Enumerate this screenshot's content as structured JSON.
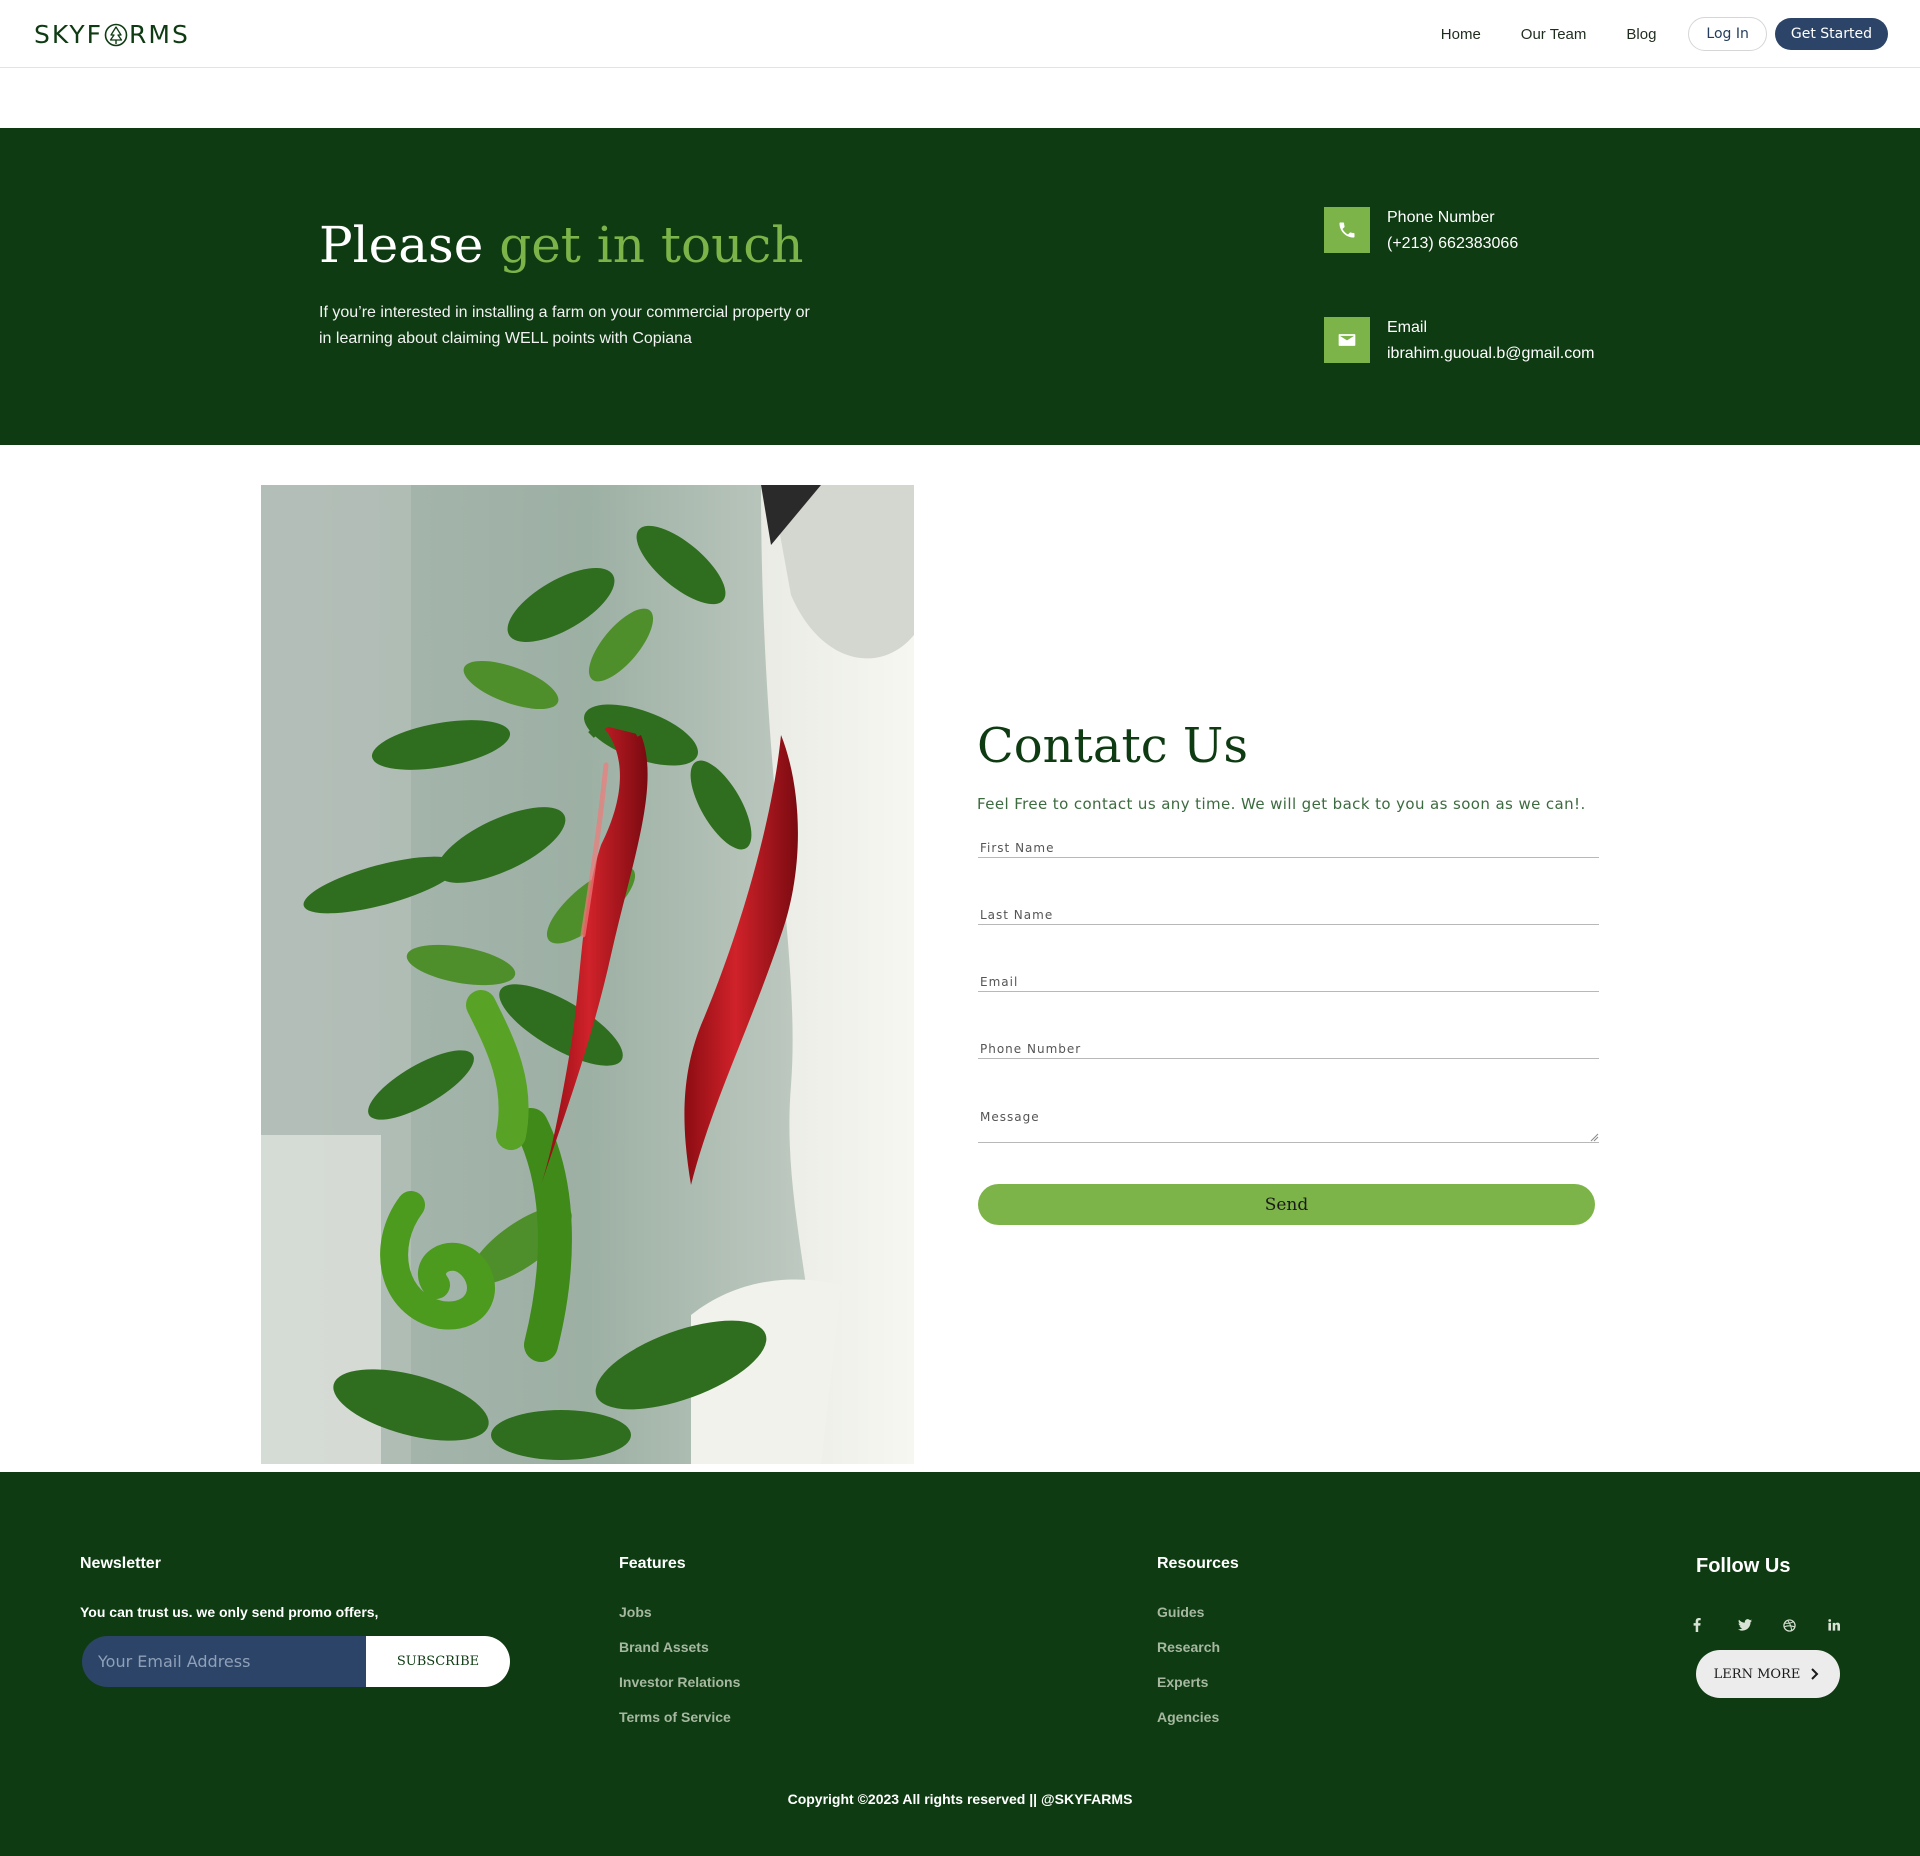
{
  "nav": {
    "logo_left": "SKYF",
    "logo_right": "RMS",
    "links": [
      "Home",
      "Our Team",
      "Blog"
    ],
    "login_label": "Log In",
    "get_started_label": "Get Started"
  },
  "hero": {
    "title_plain": "Please",
    "title_accent": "get in touch",
    "text": "If you’re interested in installing a farm on your commercial property or in learning about claiming WELL points with Copiana",
    "phone_label": "Phone Number",
    "phone_value": "(+213) 662383066",
    "email_label": "Email",
    "email_value": "ibrahim.guoual.b@gmail.com"
  },
  "contact": {
    "title": "Contatc Us",
    "subtitle": "Feel Free to contact us any time. We will get back to you as soon as we can!.",
    "fields": [
      "First Name",
      "Last Name",
      "Email",
      "Phone Number",
      "Message"
    ],
    "send_label": "Send"
  },
  "footer": {
    "newsletter_title": "Newsletter",
    "newsletter_text": "You can trust us. we only send promo offers,",
    "email_placeholder": "Your Email Address",
    "subscribe_label": "SUBSCRIBE",
    "features_title": "Features",
    "features": [
      "Jobs",
      "Brand Assets",
      "Investor Relations",
      "Terms of Service"
    ],
    "resources_title": "Resources",
    "resources": [
      "Guides",
      "Research",
      "Experts",
      "Agencies"
    ],
    "follow_title": "Follow Us",
    "socials": [
      "facebook-icon",
      "twitter-icon",
      "dribbble-icon",
      "linkedin-icon"
    ],
    "learn_more_label": "LERN MORE",
    "copyright": "Copyright ©2023 All rights reserved || @SKYFARMS"
  },
  "colors": {
    "dark_green": "#0e3b12",
    "accent_green": "#7db449",
    "navy": "#2c4467"
  }
}
